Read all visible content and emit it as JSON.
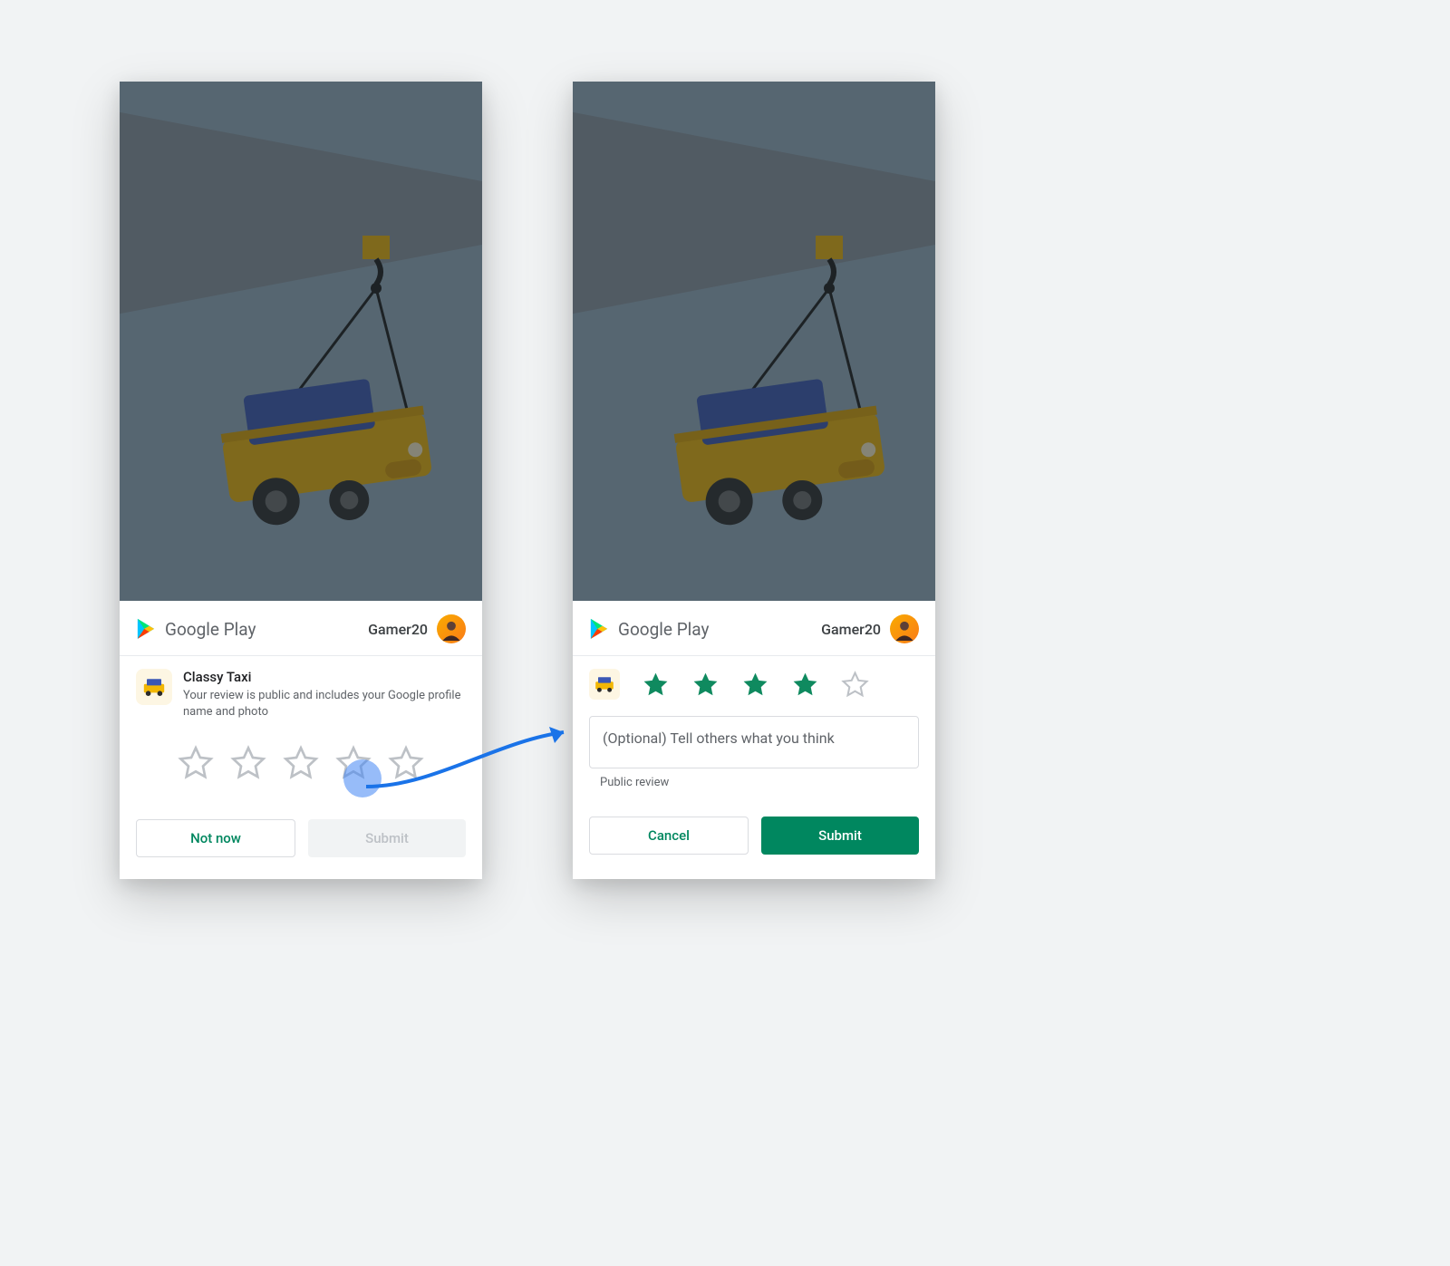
{
  "brand": {
    "name": "Google Play"
  },
  "user": {
    "name": "Gamer20"
  },
  "screen1": {
    "app_name": "Classy Taxi",
    "privacy_note": "Your review is public and includes your Google profile name and photo",
    "rating_selected": 0,
    "buttons": {
      "not_now": "Not now",
      "submit": "Submit"
    }
  },
  "screen2": {
    "rating_selected": 4,
    "review_placeholder": "(Optional) Tell others what you think",
    "public_label": "Public review",
    "buttons": {
      "cancel": "Cancel",
      "submit": "Submit"
    }
  },
  "colors": {
    "accent_green": "#00875f",
    "star_filled": "#0f9d58",
    "star_outline": "#bdc1c6",
    "arrow_blue": "#1a73e8"
  }
}
